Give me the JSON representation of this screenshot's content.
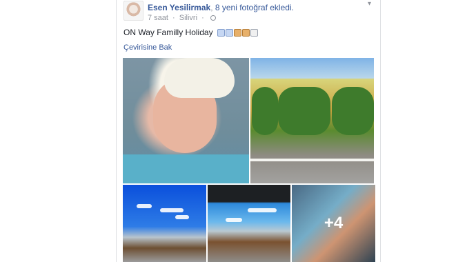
{
  "post": {
    "author": "Esen Yesilirmak",
    "count": "8 yeni fotoğraf",
    "action_tail": " ekledi.",
    "time": "7 saat",
    "edit": "Silivri",
    "text": "ON Way Familly Holiday",
    "translate": "Çevirisine Bak",
    "more_photos": "+4"
  },
  "icons": {
    "globe": "globe-icon",
    "chevron": "chevron-down-icon",
    "emoji": "emoji-icons"
  }
}
